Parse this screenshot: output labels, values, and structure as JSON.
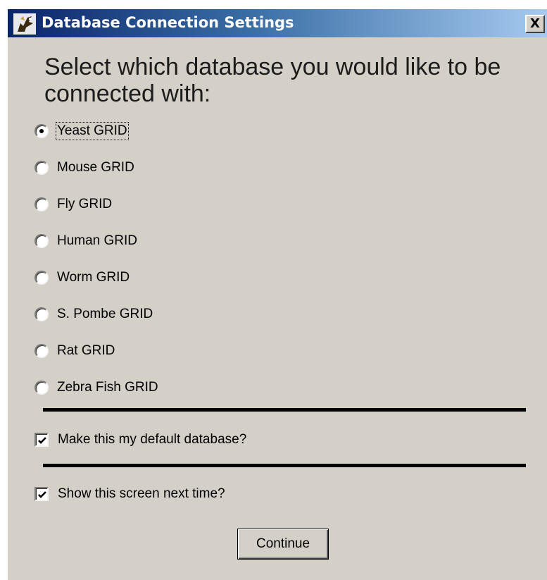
{
  "window": {
    "title": "Database Connection Settings",
    "close_label": "X"
  },
  "prompt": "Select which database you would like to be connected with:",
  "databases": {
    "selected_index": 0,
    "options": [
      {
        "label": "Yeast GRID",
        "checked": true
      },
      {
        "label": "Mouse GRID",
        "checked": false
      },
      {
        "label": "Fly GRID",
        "checked": false
      },
      {
        "label": "Human GRID",
        "checked": false
      },
      {
        "label": "Worm GRID",
        "checked": false
      },
      {
        "label": "S. Pombe GRID",
        "checked": false
      },
      {
        "label": "Rat GRID",
        "checked": false
      },
      {
        "label": "Zebra Fish GRID",
        "checked": false
      }
    ]
  },
  "options": {
    "default_db": {
      "label": "Make this my default database?",
      "checked": true
    },
    "show_next_time": {
      "label": "Show this screen next time?",
      "checked": true
    }
  },
  "actions": {
    "continue_label": "Continue"
  },
  "colors": {
    "dialog_bg": "#d4d0c8",
    "titlebar_start": "#0a246a",
    "titlebar_end": "#a6caf0",
    "text": "#000000"
  }
}
